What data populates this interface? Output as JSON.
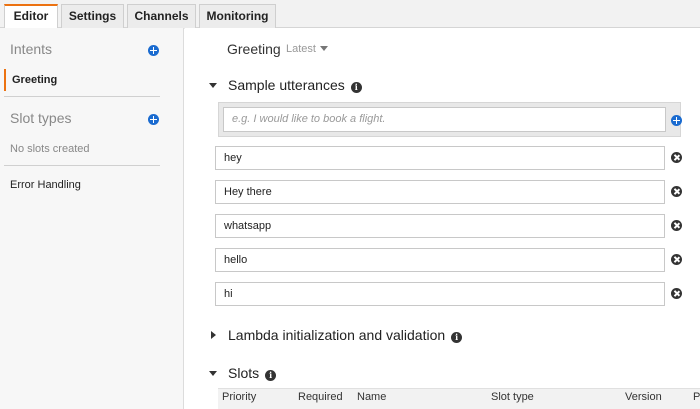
{
  "tabs": [
    {
      "label": "Editor",
      "active": true
    },
    {
      "label": "Settings",
      "active": false
    },
    {
      "label": "Channels",
      "active": false
    },
    {
      "label": "Monitoring",
      "active": false
    }
  ],
  "sidebar": {
    "intents_title": "Intents",
    "intents": [
      {
        "label": "Greeting",
        "selected": true
      }
    ],
    "slot_types_title": "Slot types",
    "slot_types_empty": "No slots created",
    "error_handling": "Error Handling"
  },
  "main": {
    "intent_name": "Greeting",
    "version": "Latest",
    "sample_utterances": {
      "title": "Sample utterances",
      "placeholder": "e.g. I would like to book a flight.",
      "items": [
        "hey",
        "Hey there",
        "whatsapp",
        "hello",
        "hi"
      ]
    },
    "lambda_section": "Lambda initialization and validation",
    "slots": {
      "title": "Slots",
      "columns": [
        "Priority",
        "Required",
        "Name",
        "Slot type",
        "Version",
        "P"
      ]
    }
  },
  "colors": {
    "accent": "#ec7211",
    "add_icon": "#1a6bd0",
    "remove_icon": "#333333"
  },
  "icons": {
    "add": "plus-circle-icon",
    "remove": "x-circle-icon",
    "info": "info-icon"
  }
}
